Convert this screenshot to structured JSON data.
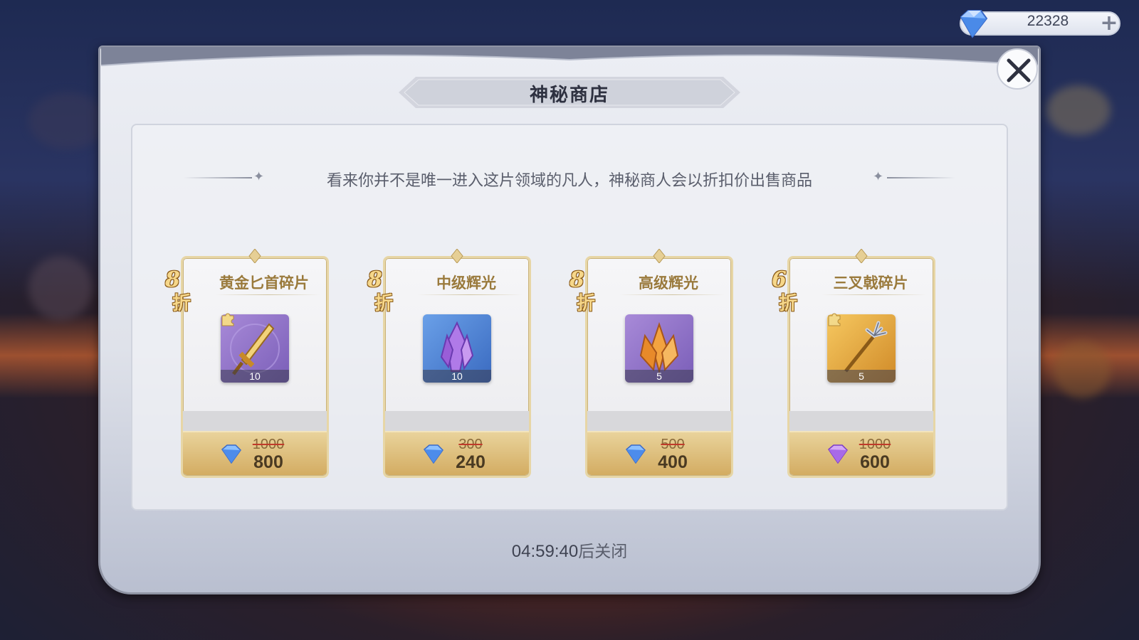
{
  "currency": {
    "amount": "22328",
    "icon": "diamond-gem-icon",
    "add_icon": "plus-icon"
  },
  "shop": {
    "title": "神秘商店",
    "subtitle": "看来你并不是唯一进入这片领域的凡人，神秘商人会以折扣价出售商品",
    "timer": "04:59:40",
    "timer_suffix": "后关闭"
  },
  "items": [
    {
      "name": "黄金匕首碎片",
      "discount_num": "8",
      "discount_unit": "折",
      "count": "10",
      "old_price": "1000",
      "new_price": "800",
      "icon": "golden-dagger-icon",
      "currency_icon": "blue-diamond-icon",
      "shard": true
    },
    {
      "name": "中级辉光",
      "discount_num": "8",
      "discount_unit": "折",
      "count": "10",
      "old_price": "300",
      "new_price": "240",
      "icon": "purple-crystal-icon",
      "currency_icon": "blue-diamond-icon",
      "shard": false
    },
    {
      "name": "高级辉光",
      "discount_num": "8",
      "discount_unit": "折",
      "count": "5",
      "old_price": "500",
      "new_price": "400",
      "icon": "orange-crystal-icon",
      "currency_icon": "blue-diamond-icon",
      "shard": false
    },
    {
      "name": "三叉戟碎片",
      "discount_num": "6",
      "discount_unit": "折",
      "count": "5",
      "old_price": "1000",
      "new_price": "600",
      "icon": "golden-trident-icon",
      "currency_icon": "purple-diamond-icon",
      "shard": true
    }
  ]
}
